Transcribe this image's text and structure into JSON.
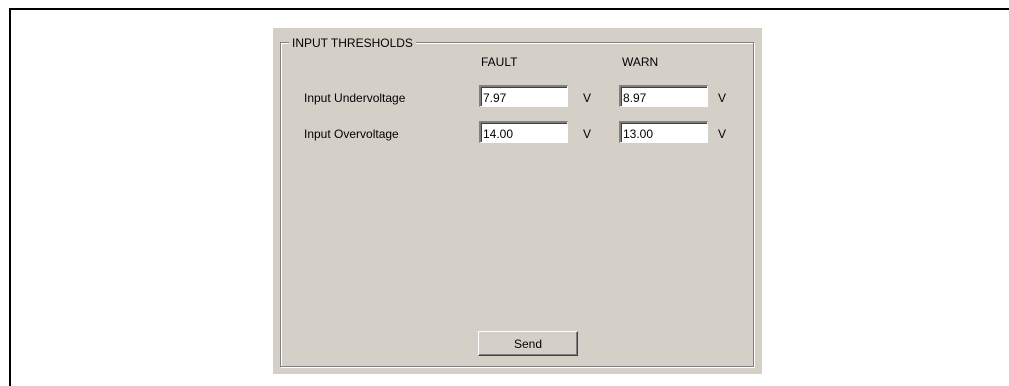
{
  "group": {
    "title": "INPUT THRESHOLDS"
  },
  "columns": {
    "fault": "FAULT",
    "warn": "WARN"
  },
  "rows": [
    {
      "label": "Input Undervoltage",
      "fault_value": "7.97",
      "fault_unit": "V",
      "warn_value": "8.97",
      "warn_unit": "V"
    },
    {
      "label": "Input Overvoltage",
      "fault_value": "14.00",
      "fault_unit": "V",
      "warn_value": "13.00",
      "warn_unit": "V"
    }
  ],
  "actions": {
    "send_label": "Send"
  },
  "colors": {
    "panel_background": "#d4d0c8",
    "page_background": "#ffffff"
  }
}
